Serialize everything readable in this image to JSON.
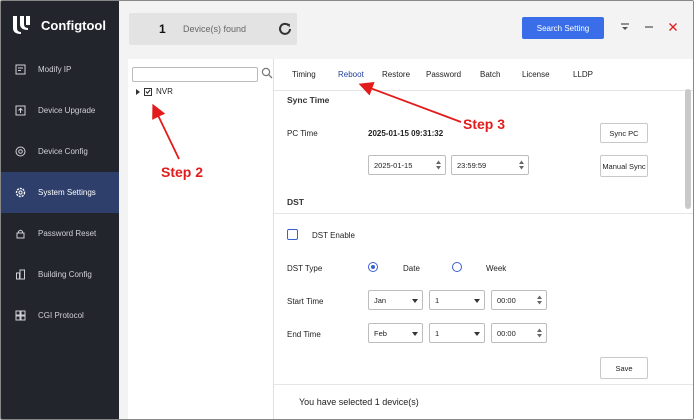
{
  "app": {
    "name": "Configtool"
  },
  "topbar": {
    "device_count": "1",
    "device_found_label": "Device(s) found",
    "search_setting_label": "Search Setting"
  },
  "sidebar": {
    "items": [
      {
        "label": "Modify IP",
        "icon": "modify-ip-icon"
      },
      {
        "label": "Device Upgrade",
        "icon": "upload-icon"
      },
      {
        "label": "Device Config",
        "icon": "target-icon"
      },
      {
        "label": "System Settings",
        "icon": "gear-icon",
        "active": true
      },
      {
        "label": "Password Reset",
        "icon": "lock-icon"
      },
      {
        "label": "Building Config",
        "icon": "building-icon"
      },
      {
        "label": "CGI Protocol",
        "icon": "protocol-icon"
      }
    ]
  },
  "tree": {
    "search_placeholder": "",
    "node_label": "NVR"
  },
  "tabs": [
    "Timing",
    "Reboot",
    "Restore",
    "Password",
    "Batch",
    "License",
    "LLDP"
  ],
  "sync_time": {
    "title": "Sync Time",
    "pc_time_label": "PC Time",
    "pc_time_value": "2025-01-15 09:31:32",
    "sync_pc_label": "Sync PC",
    "date_value": "2025-01-15",
    "time_value": "23:59:59",
    "manual_sync_label": "Manual Sync"
  },
  "dst": {
    "title": "DST",
    "enable_label": "DST Enable",
    "type_label": "DST Type",
    "type_date": "Date",
    "type_week": "Week",
    "start_label": "Start Time",
    "start_month": "Jan",
    "start_day": "1",
    "start_time": "00:00",
    "end_label": "End Time",
    "end_month": "Feb",
    "end_day": "1",
    "end_time": "00:00",
    "save_label": "Save"
  },
  "footer": {
    "selected_text": "You have selected 1 device(s)"
  },
  "annotations": {
    "step2": "Step 2",
    "step3": "Step 3"
  },
  "colors": {
    "sidebar_bg": "#23252d",
    "active_nav": "#2f3f6b",
    "accent": "#3a6ee8",
    "annotation": "#e21c1c"
  }
}
